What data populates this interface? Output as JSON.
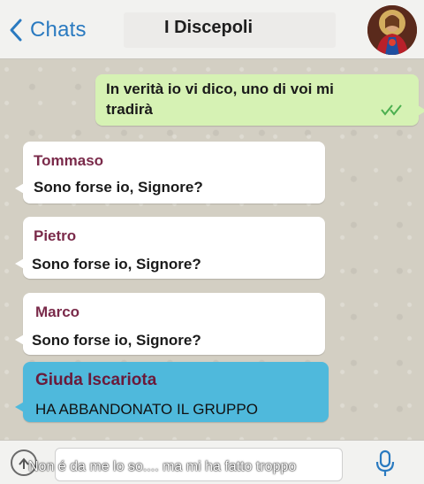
{
  "header": {
    "back_label": "Chats",
    "title": "I Discepoli"
  },
  "messages": [
    {
      "type": "outgoing",
      "text_line1": "In verità io vi dico, uno di voi mi",
      "text_line2": "tradirà"
    },
    {
      "type": "incoming",
      "sender": "Tommaso",
      "text": "Sono forse io, Signore?"
    },
    {
      "type": "incoming",
      "sender": "Pietro",
      "text": "Sono forse io, Signore?"
    },
    {
      "type": "incoming",
      "sender": "Marco",
      "text": "Sono forse io, Signore?"
    },
    {
      "type": "system",
      "sender": "Giuda Iscariota",
      "text": "HA ABBANDONATO IL GRUPPO"
    }
  ],
  "footer": {
    "caption": "Non é da me lo so.... ma mi ha fatto troppo"
  },
  "colors": {
    "accent": "#2a7ac0",
    "outgoing_bubble": "#d6f2b4",
    "system_bubble": "#4fb9dc",
    "read_ticks": "#4caf50"
  },
  "icons": {
    "back": "chevron-left-icon",
    "read_status": "double-check-icon",
    "attach": "attach-icon",
    "mic": "microphone-icon"
  }
}
